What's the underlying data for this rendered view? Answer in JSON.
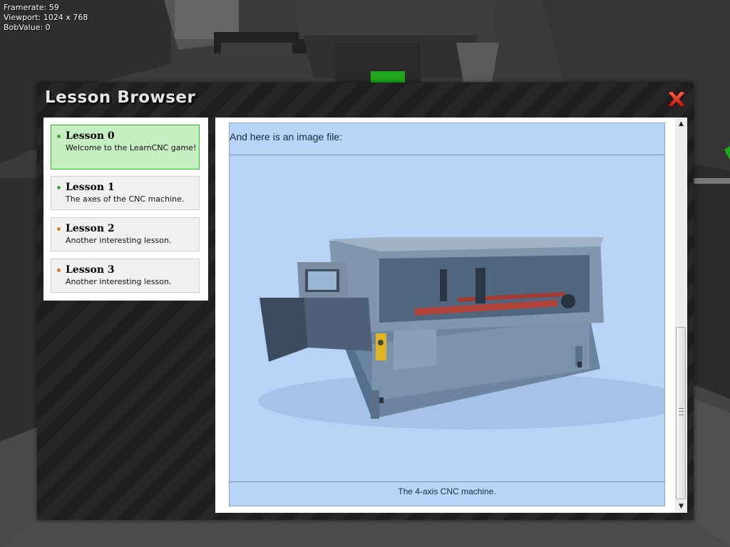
{
  "hud": {
    "framerate": "Framerate: 59",
    "viewport": "Viewport: 1024 x 768",
    "bobvalue": "BobValue: 0"
  },
  "window": {
    "title": "Lesson Browser",
    "close_icon": "close-x-icon"
  },
  "lessons": [
    {
      "title": "Lesson 0",
      "description": "Welcome to the LearnCNC game!",
      "status_color": "#3aa83a",
      "active": true
    },
    {
      "title": "Lesson 1",
      "description": "The axes of the CNC machine.",
      "status_color": "#3aa83a",
      "active": false
    },
    {
      "title": "Lesson 2",
      "description": "Another interesting lesson.",
      "status_color": "#e07a1a",
      "active": false
    },
    {
      "title": "Lesson 3",
      "description": "Another interesting lesson.",
      "status_color": "#e07a1a",
      "active": false
    }
  ],
  "content": {
    "intro": "And here is an image file:",
    "image_alt_icon": "cnc-machine-image",
    "caption": "The 4-axis CNC machine."
  },
  "colors": {
    "active_lesson_bg": "#c5efc0",
    "active_lesson_border": "#2fbb2f",
    "content_bg": "#b8d4f6",
    "close_red": "#d8261c"
  },
  "scrollbar": {
    "up_icon": "scroll-up-arrow-icon",
    "down_icon": "scroll-down-arrow-icon",
    "position": 0.75
  }
}
